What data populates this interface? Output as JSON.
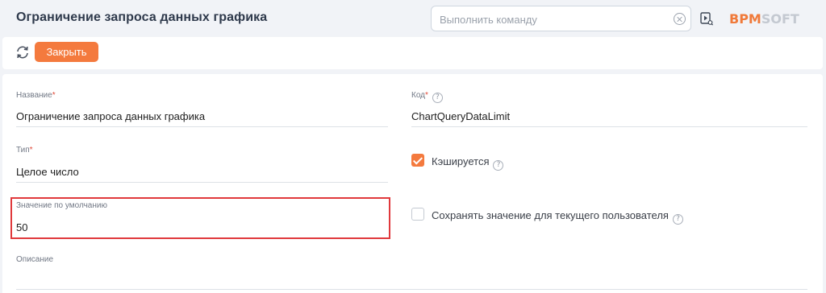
{
  "header": {
    "title": "Ограничение запроса данных графика",
    "command_placeholder": "Выполнить команду",
    "logo_part1": "BPM",
    "logo_part2": "SOFT"
  },
  "toolbar": {
    "close_label": "Закрыть"
  },
  "form": {
    "name": {
      "label": "Название",
      "required": "*",
      "value": "Ограничение запроса данных графика"
    },
    "code": {
      "label": "Код",
      "required": "*",
      "value": "ChartQueryDataLimit"
    },
    "type": {
      "label": "Тип",
      "required": "*",
      "value": "Целое число"
    },
    "default_value": {
      "label": "Значение по умолчанию",
      "value": "50"
    },
    "description": {
      "label": "Описание",
      "value": ""
    },
    "cached": {
      "label": "Кэшируется",
      "checked": true
    },
    "save_for_user": {
      "label": "Сохранять значение для текущего пользователя",
      "checked": false
    },
    "help_glyph": "?"
  },
  "colors": {
    "accent": "#f47a3e",
    "highlight_border": "#e0393c",
    "background": "#f1f3f7"
  },
  "icons": [
    "close-circle-icon",
    "process-run-icon",
    "refresh-icon",
    "help-icon"
  ]
}
